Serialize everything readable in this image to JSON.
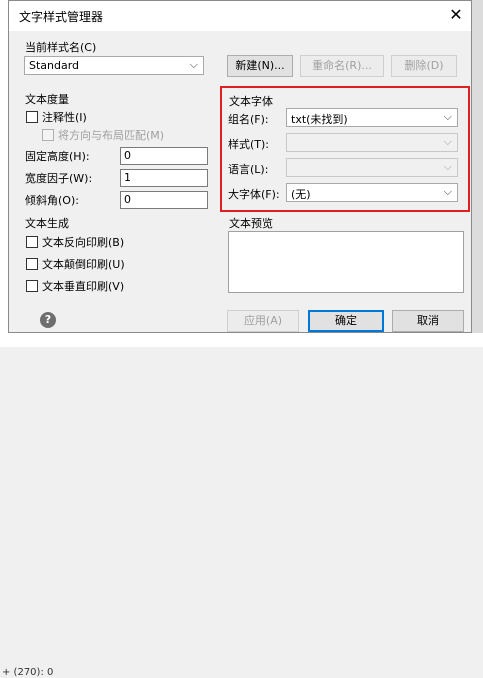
{
  "dialog": {
    "title": "文字样式管理器",
    "close_glyph": "✕"
  },
  "background": {
    "command_line_text": "+ (270): 0"
  },
  "current_style": {
    "label": "当前样式名(C)",
    "value": "Standard",
    "new_button": "新建(N)...",
    "rename_button": "重命名(R)...",
    "delete_button": "删除(D)"
  },
  "text_measure": {
    "title": "文本度量",
    "annotative_label": "注释性(I)",
    "annotative_checked": false,
    "match_orientation_label": "将方向与布局匹配(M)",
    "match_orientation_checked": false,
    "fixed_height_label": "固定高度(H):",
    "fixed_height_value": "0",
    "width_factor_label": "宽度因子(W):",
    "width_factor_value": "1",
    "oblique_angle_label": "倾斜角(O):",
    "oblique_angle_value": "0"
  },
  "text_font": {
    "title": "文本字体",
    "font_name_label": "组名(F):",
    "font_name_value": "txt(未找到)",
    "font_style_label": "样式(T):",
    "font_style_value": "",
    "language_label": "语言(L):",
    "language_value": "",
    "bigfont_label": "大字体(F):",
    "bigfont_value": "(无)"
  },
  "text_generation": {
    "title": "文本生成",
    "backwards_label": "文本反向印刷(B)",
    "backwards_checked": false,
    "upside_down_label": "文本颠倒印刷(U)",
    "upside_down_checked": false,
    "vertical_label": "文本垂直印刷(V)",
    "vertical_checked": false
  },
  "text_preview": {
    "title": "文本预览"
  },
  "footer": {
    "help_glyph": "?",
    "apply_button": "应用(A)",
    "ok_button": "确定",
    "cancel_button": "取消"
  },
  "colors": {
    "highlight_border": "#e02020",
    "default_button_border": "#0078d7"
  }
}
